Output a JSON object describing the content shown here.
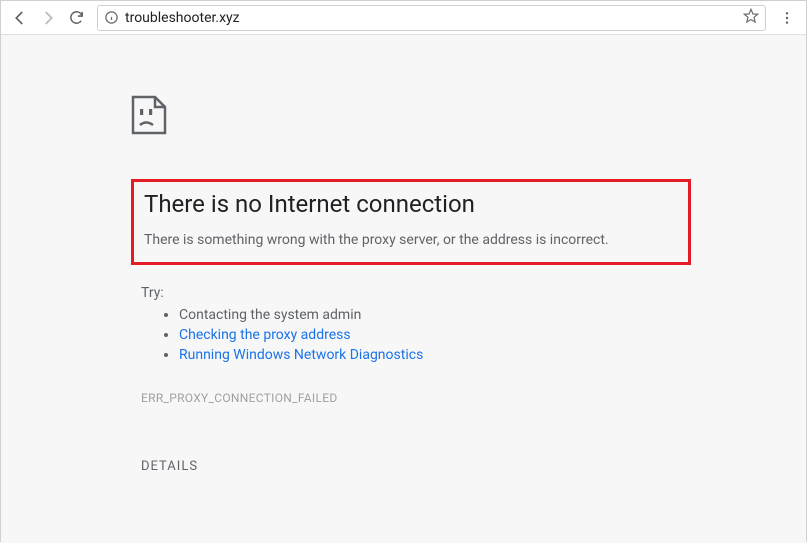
{
  "toolbar": {
    "url": "troubleshooter.xyz"
  },
  "error": {
    "title": "There is no Internet connection",
    "subtitle": "There is something wrong with the proxy server, or the address is incorrect.",
    "try_label": "Try:",
    "suggestions": {
      "item0": "Contacting the system admin",
      "item1": "Checking the proxy address",
      "item2": "Running Windows Network Diagnostics"
    },
    "code": "ERR_PROXY_CONNECTION_FAILED",
    "details_label": "DETAILS"
  }
}
